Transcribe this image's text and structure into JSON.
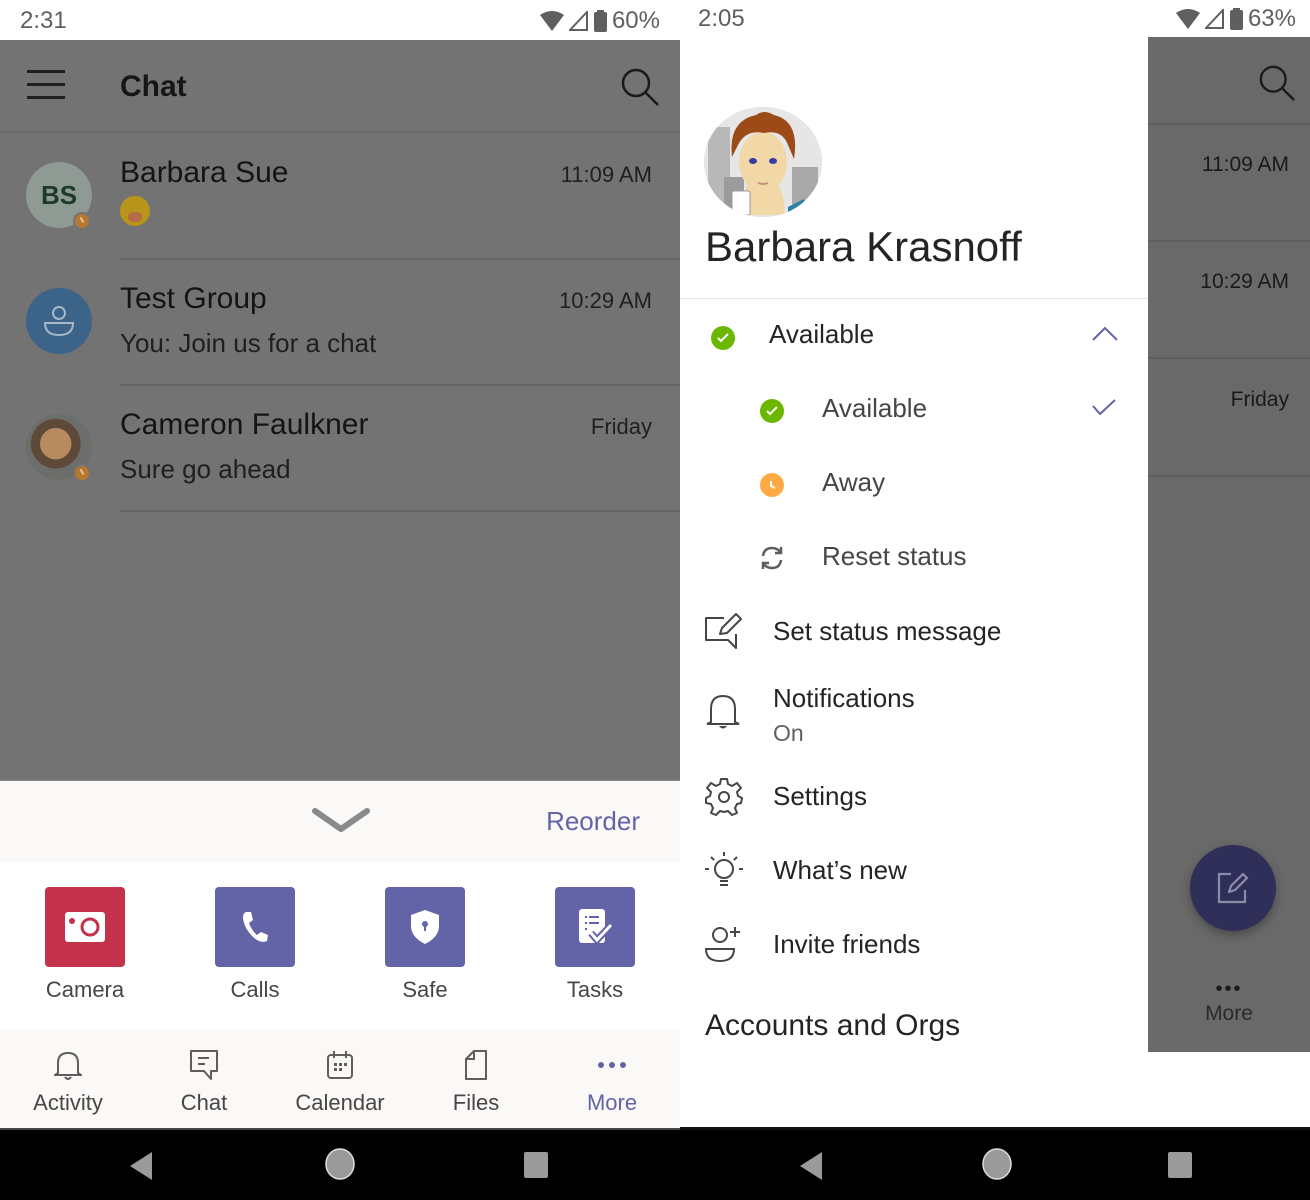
{
  "left_screen": {
    "status_bar": {
      "time": "2:31",
      "battery": "60%"
    },
    "header": {
      "title": "Chat"
    },
    "chats": [
      {
        "name": "Barbara Sue",
        "initials": "BS",
        "preview": "",
        "preview_emoji": "face-with-hand-over-mouth",
        "time": "11:09 AM",
        "presence": "away"
      },
      {
        "name": "Test Group",
        "preview": "You: Join us for a chat",
        "time": "10:29 AM",
        "avatar": "group"
      },
      {
        "name": "Cameron Faulkner",
        "preview": "Sure go ahead",
        "time": "Friday",
        "presence": "away",
        "avatar": "photo"
      }
    ],
    "more_sheet": {
      "reorder_label": "Reorder",
      "apps": [
        {
          "label": "Camera",
          "icon": "camera-icon",
          "color": "#c4314b"
        },
        {
          "label": "Calls",
          "icon": "phone-icon",
          "color": "#6264a7"
        },
        {
          "label": "Safe",
          "icon": "shield-lock-icon",
          "color": "#6264a7"
        },
        {
          "label": "Tasks",
          "icon": "tasks-icon",
          "color": "#6264a7"
        }
      ]
    },
    "bottom_nav": [
      {
        "label": "Activity",
        "icon": "bell-icon"
      },
      {
        "label": "Chat",
        "icon": "chat-icon"
      },
      {
        "label": "Calendar",
        "icon": "calendar-icon"
      },
      {
        "label": "Files",
        "icon": "file-icon"
      },
      {
        "label": "More",
        "icon": "more-icon",
        "active": true
      }
    ]
  },
  "right_screen": {
    "status_bar": {
      "time": "2:05",
      "battery": "63%"
    },
    "profile": {
      "name": "Barbara Krasnoff"
    },
    "status": {
      "current": "Available",
      "options": [
        {
          "label": "Available",
          "selected": true,
          "color": "#6bb700"
        },
        {
          "label": "Away",
          "color": "#ffaa44"
        },
        {
          "label": "Reset status"
        }
      ]
    },
    "menu": [
      {
        "label": "Set status message",
        "icon": "edit-message-icon"
      },
      {
        "label": "Notifications",
        "sublabel": "On",
        "icon": "bell-icon"
      },
      {
        "label": "Settings",
        "icon": "gear-icon"
      },
      {
        "label": "What’s new",
        "icon": "lightbulb-icon"
      },
      {
        "label": "Invite friends",
        "icon": "add-person-icon"
      }
    ],
    "accounts_title": "Accounts and Orgs",
    "background": {
      "times": [
        "11:09 AM",
        "10:29 AM",
        "Friday"
      ],
      "more_label": "More"
    }
  },
  "colors": {
    "accent": "#6264a7",
    "available": "#6bb700",
    "away": "#ffaa44",
    "camera": "#c4314b"
  }
}
